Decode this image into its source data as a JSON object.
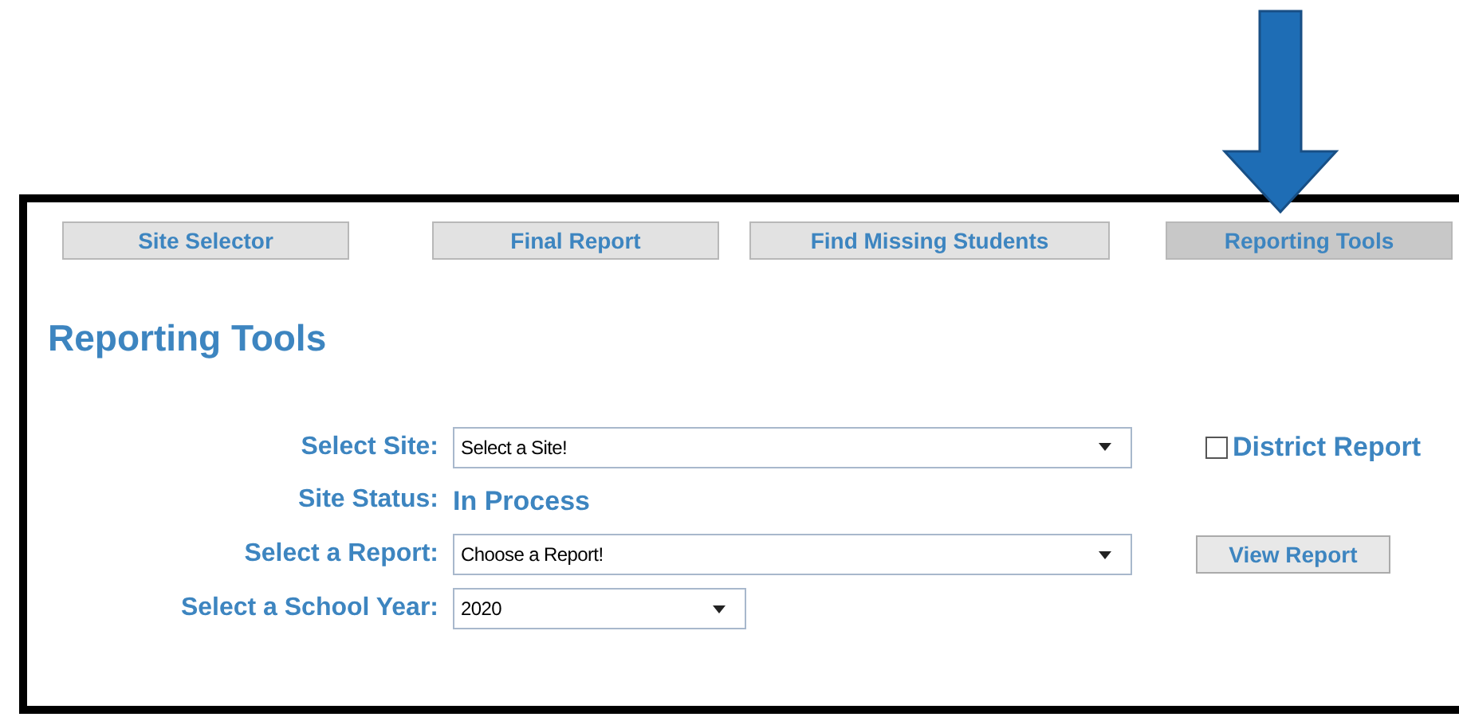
{
  "tabs": [
    {
      "label": "Site Selector",
      "selected": false
    },
    {
      "label": "Final Report",
      "selected": false
    },
    {
      "label": "Find Missing Students",
      "selected": false
    },
    {
      "label": "Reporting Tools",
      "selected": true
    }
  ],
  "heading": "Reporting Tools",
  "form": {
    "site": {
      "label": "Select Site:",
      "value": "Select a Site!"
    },
    "district_report": {
      "label": "District Report",
      "checked": false
    },
    "status": {
      "label": "Site Status:",
      "value": "In Process"
    },
    "report": {
      "label": "Select a Report:",
      "value": "Choose a Report!"
    },
    "view_button": "View Report",
    "year": {
      "label": "Select a School Year:",
      "value": "2020"
    }
  }
}
